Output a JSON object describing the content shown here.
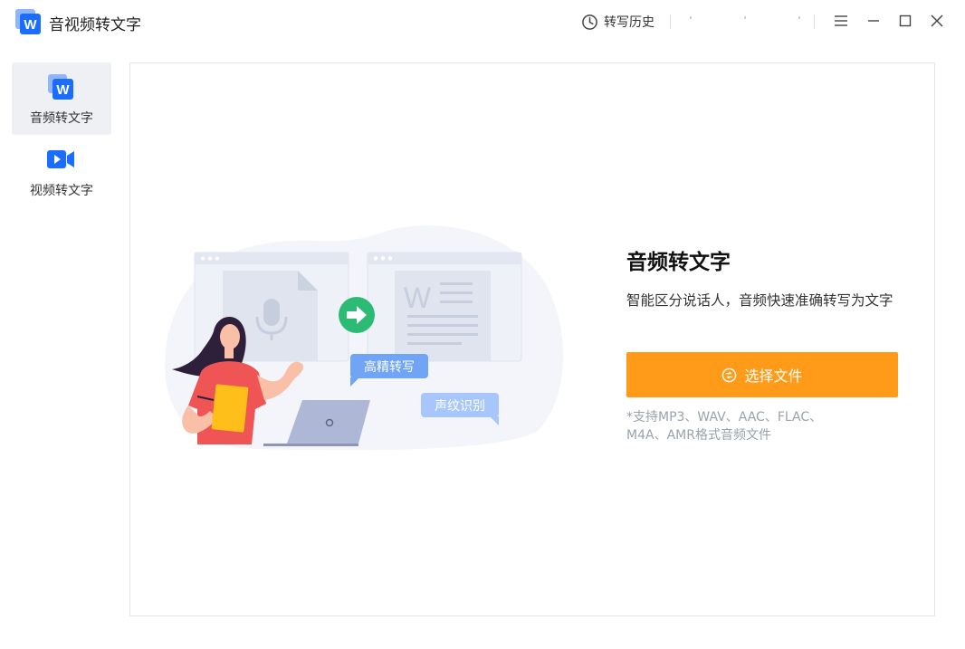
{
  "app": {
    "title": "音视频转文字"
  },
  "header": {
    "history_label": "转写历史"
  },
  "sidebar": {
    "items": [
      {
        "label": "音频转文字",
        "active": true
      },
      {
        "label": "视频转文字",
        "active": false
      }
    ]
  },
  "main": {
    "heading": "音频转文字",
    "subheading": "智能区分说话人，音频快速准确转写为文字",
    "select_button_label": "选择文件",
    "hint_line1": "*支持MP3、WAV、AAC、FLAC、",
    "hint_line2": "M4A、AMR格式音频文件",
    "badge_hd": "高精转写",
    "badge_voiceprint": "声纹识别"
  },
  "colors": {
    "accent_orange": "#ff9b19",
    "brand_blue": "#1a6dff",
    "arrow_green": "#2bbb75",
    "bubble_blue": "#6fa4f6",
    "bubble_light": "#a7c6fb"
  },
  "icons": {
    "app_logo": "w-doc-icon",
    "history": "clock-icon",
    "menu": "hamburger-icon",
    "minimize": "minimize-icon",
    "maximize": "maximize-icon",
    "close": "close-icon",
    "audio_nav": "w-doc-icon",
    "video_nav": "video-camera-icon",
    "select_file": "shuffle-icon"
  }
}
